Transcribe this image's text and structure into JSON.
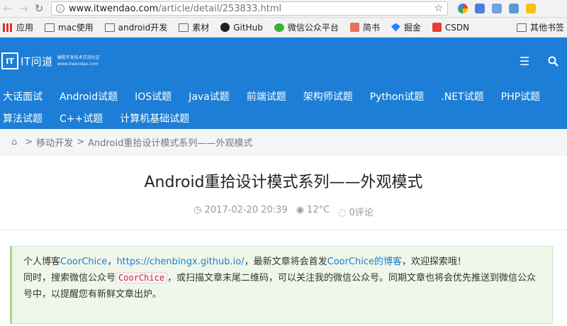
{
  "browser": {
    "back_icon": "arrow-left-icon",
    "forward_icon": "arrow-right-icon",
    "reload_icon": "reload-icon",
    "url_host": "www.itwendao.com",
    "url_path": "/article/detail/253833.html",
    "bookmark_star_icon": "star-icon",
    "extension_colors": [
      "#f4b400",
      "#4a7fe0",
      "#6fa2e6",
      "#5b9bd5",
      "#f5c400"
    ]
  },
  "bookmarks": {
    "items": [
      {
        "label": "应用",
        "icon": "apps-grid-icon"
      },
      {
        "label": "mac使用",
        "icon": "folder-icon"
      },
      {
        "label": "android开发",
        "icon": "folder-icon"
      },
      {
        "label": "素材",
        "icon": "folder-icon"
      },
      {
        "label": "GitHub",
        "icon": "github-icon"
      },
      {
        "label": "微信公众平台",
        "icon": "wechat-icon"
      },
      {
        "label": "简书",
        "icon": "jianshu-icon"
      },
      {
        "label": "掘金",
        "icon": "juejin-icon"
      },
      {
        "label": "CSDN",
        "icon": "csdn-icon"
      }
    ],
    "overflow_label": "其他书签"
  },
  "site": {
    "logo_mark": "IT",
    "logo_name": "IT问道",
    "logo_sub1": "编程开发技术交流社区",
    "logo_sub2": "www.itwendao.com",
    "menu_icon": "hamburger-menu-icon",
    "search_icon": "search-icon",
    "nav_row1": [
      "大话面试",
      "Android试题",
      "IOS试题",
      "Java试题",
      "前端试题",
      "架构师试题",
      "Python试题",
      ".NET试题",
      "PHP试题"
    ],
    "nav_row2": [
      "算法试题",
      "C++试题",
      "计算机基础试题"
    ]
  },
  "breadcrumb": {
    "home_icon": "home-icon",
    "separator": ">",
    "category": "移动开发",
    "current": "Android重拾设计模式系列——外观模式"
  },
  "article": {
    "title": "Android重拾设计模式系列——外观模式",
    "date": "2017-02-20 20:39",
    "views": "12°C",
    "comments": "0评论",
    "notice": {
      "line1_prefix": "个人博客",
      "blog_name": "CoorChice",
      "comma1": "，",
      "blog_url": "https://chenbingx.github.io/",
      "line1_middle": "，最新文章将会首发",
      "blog_link": "CoorChice的博客",
      "line1_suffix": "，欢迎探索哦！",
      "line2_prefix": "同时，搜索微信公众号",
      "wechat_id": "CoorChice",
      "line2_suffix": "，或扫描文章末尾二维码，可以关注我的微信公众号。同期文章也将会优先推送到微信公众号中，以提醒您有新鲜文章出炉。"
    }
  }
}
